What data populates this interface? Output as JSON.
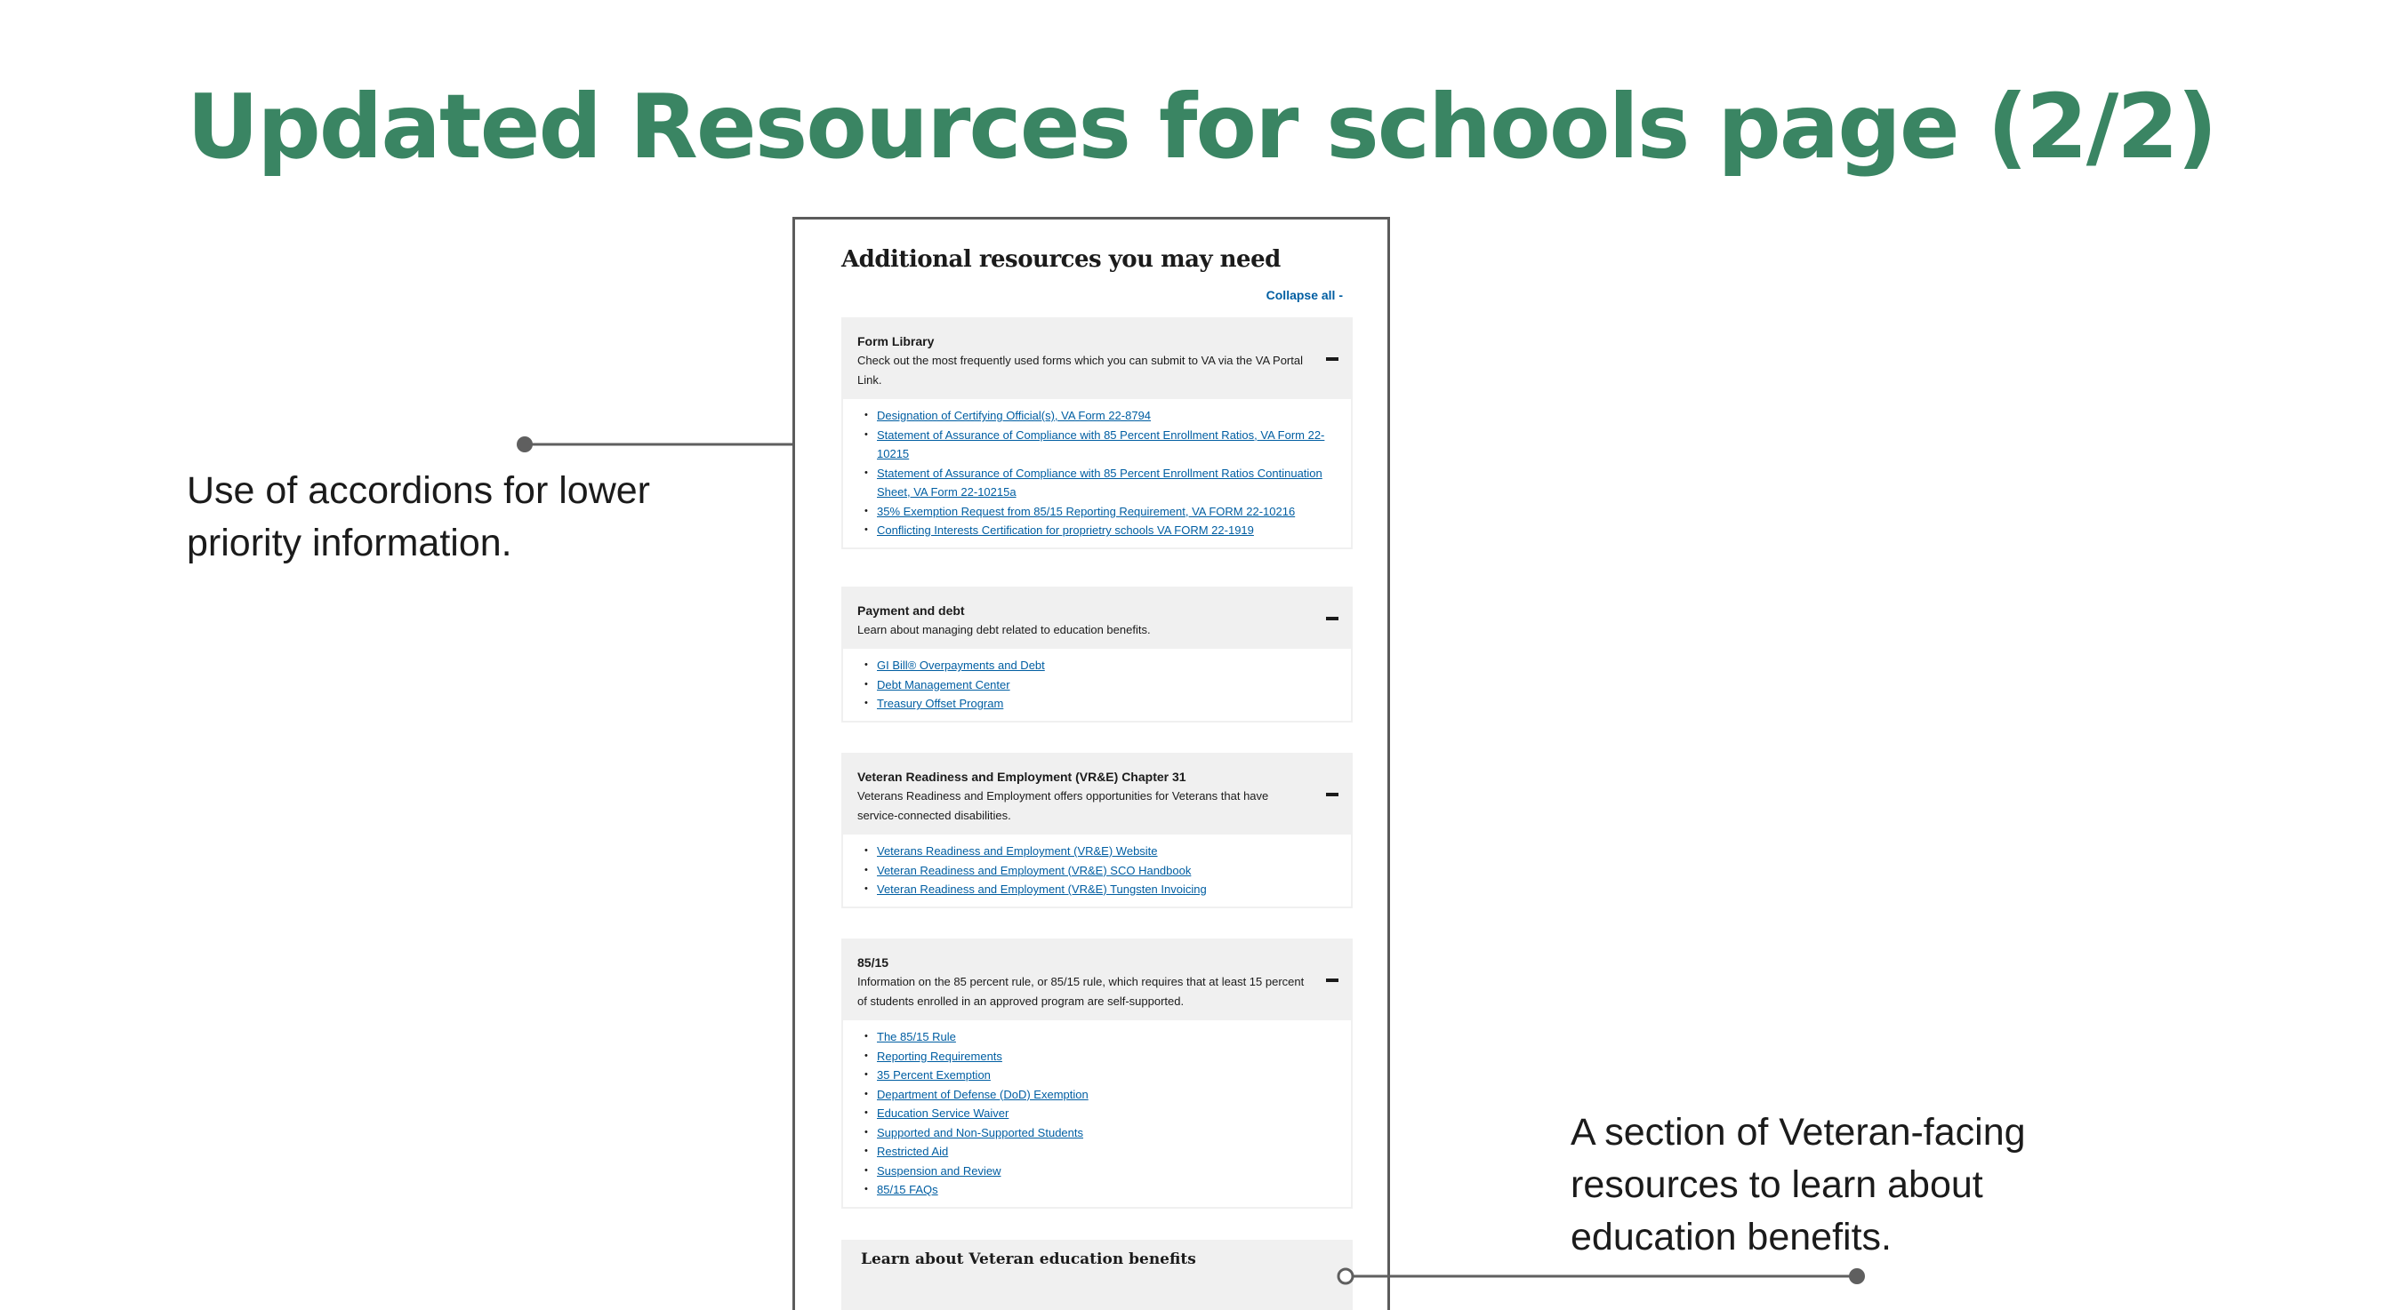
{
  "slide": {
    "title": "Updated Resources for schools page (2/2)",
    "title_color": "#3a8563"
  },
  "callouts": {
    "left": "Use of accordions for lower priority information.",
    "right": "A section of Veteran-facing resources to learn about education benefits."
  },
  "mockup": {
    "heading": "Additional resources you may need",
    "collapse_all": "Collapse all -",
    "link_color": "#005ea2",
    "accordions": [
      {
        "title": "Form Library",
        "description": "Check out the most frequently used forms which you can submit to VA via the VA Portal Link.",
        "toggle_icon": "minus-icon",
        "links": [
          "Designation of Certifying Official(s), VA Form 22-8794",
          "Statement of Assurance of Compliance with 85 Percent Enrollment Ratios, VA Form 22-10215",
          "Statement of Assurance of Compliance with 85 Percent Enrollment Ratios Continuation Sheet, VA Form 22-10215a",
          "35% Exemption Request from 85/15 Reporting Requirement, VA FORM 22-10216",
          "Conflicting Interests Certification for proprietry schools VA FORM 22-1919"
        ]
      },
      {
        "title": "Payment and debt",
        "description": "Learn about managing debt related to education benefits.",
        "toggle_icon": "minus-icon",
        "links": [
          "GI Bill® Overpayments and Debt",
          "Debt Management Center",
          "Treasury Offset Program"
        ]
      },
      {
        "title": "Veteran Readiness and Employment (VR&E) Chapter 31",
        "description": "Veterans Readiness and Employment offers opportunities for Veterans that have service-connected disabilities.",
        "toggle_icon": "minus-icon",
        "links": [
          "Veterans Readiness and Employment (VR&E) Website",
          "Veteran Readiness and Employment (VR&E) SCO Handbook",
          "Veteran Readiness and Employment (VR&E) Tungsten Invoicing"
        ]
      },
      {
        "title": "85/15",
        "description": "Information on the 85 percent rule, or 85/15 rule, which requires that at least 15 percent of students enrolled in an approved program are self-supported.",
        "toggle_icon": "minus-icon",
        "links": [
          "The 85/15 Rule",
          "Reporting Requirements",
          "35 Percent Exemption",
          "Department of Defense (DoD) Exemption",
          "Education Service Waiver",
          "Supported and Non-Supported Students",
          "Restricted Aid",
          "Suspension and Review",
          "85/15 FAQs"
        ]
      }
    ],
    "learn_box_title": "Learn about Veteran education benefits"
  }
}
